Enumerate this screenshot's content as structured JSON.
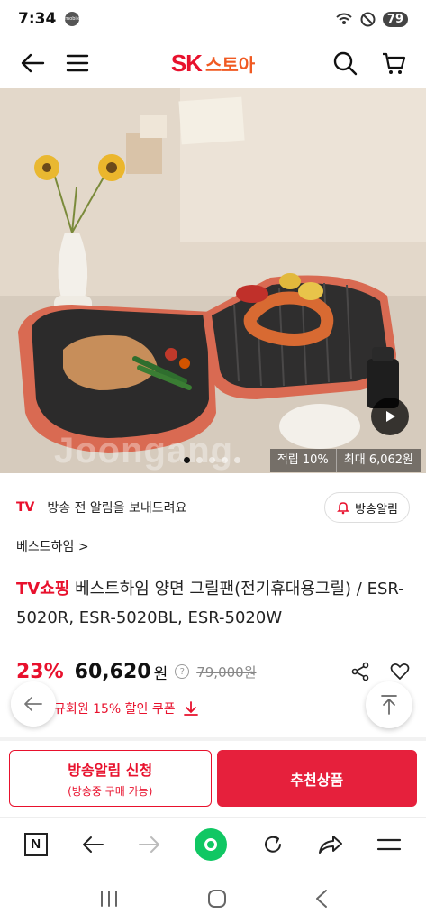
{
  "status_bar": {
    "time": "7:34",
    "chip": "mobile vats",
    "battery": "79"
  },
  "header": {
    "logo_sk": "SK",
    "logo_store": "스토아"
  },
  "hero": {
    "watermark": "Joongang",
    "badge_points": "적립 10%",
    "badge_max": "최대 6,062원",
    "slide_count": 5,
    "active_slide": 1
  },
  "tv": {
    "tag": "TV",
    "message": "방송 전 알림을 보내드려요",
    "alarm_label": "방송알림"
  },
  "product": {
    "breadcrumb": "베스트하임 >",
    "title_tag": "TV쇼핑",
    "title": " 베스트하임 양면 그릴팬(전기휴대용그릴) / ESR-5020R, ESR-5020BL, ESR-5020W",
    "discount": "23%",
    "price": "60,620",
    "currency": "원",
    "original_price": "79,000원",
    "coupon": "규회원 15% 할인 쿠폰"
  },
  "cta": {
    "broadcast_label": "방송알림 신청",
    "broadcast_sub": "(방송중 구매 가능)",
    "recommend_label": "추천상품"
  },
  "colors": {
    "brand_red": "#e8112d",
    "accent_orange": "#f05a22",
    "green": "#10c763"
  }
}
